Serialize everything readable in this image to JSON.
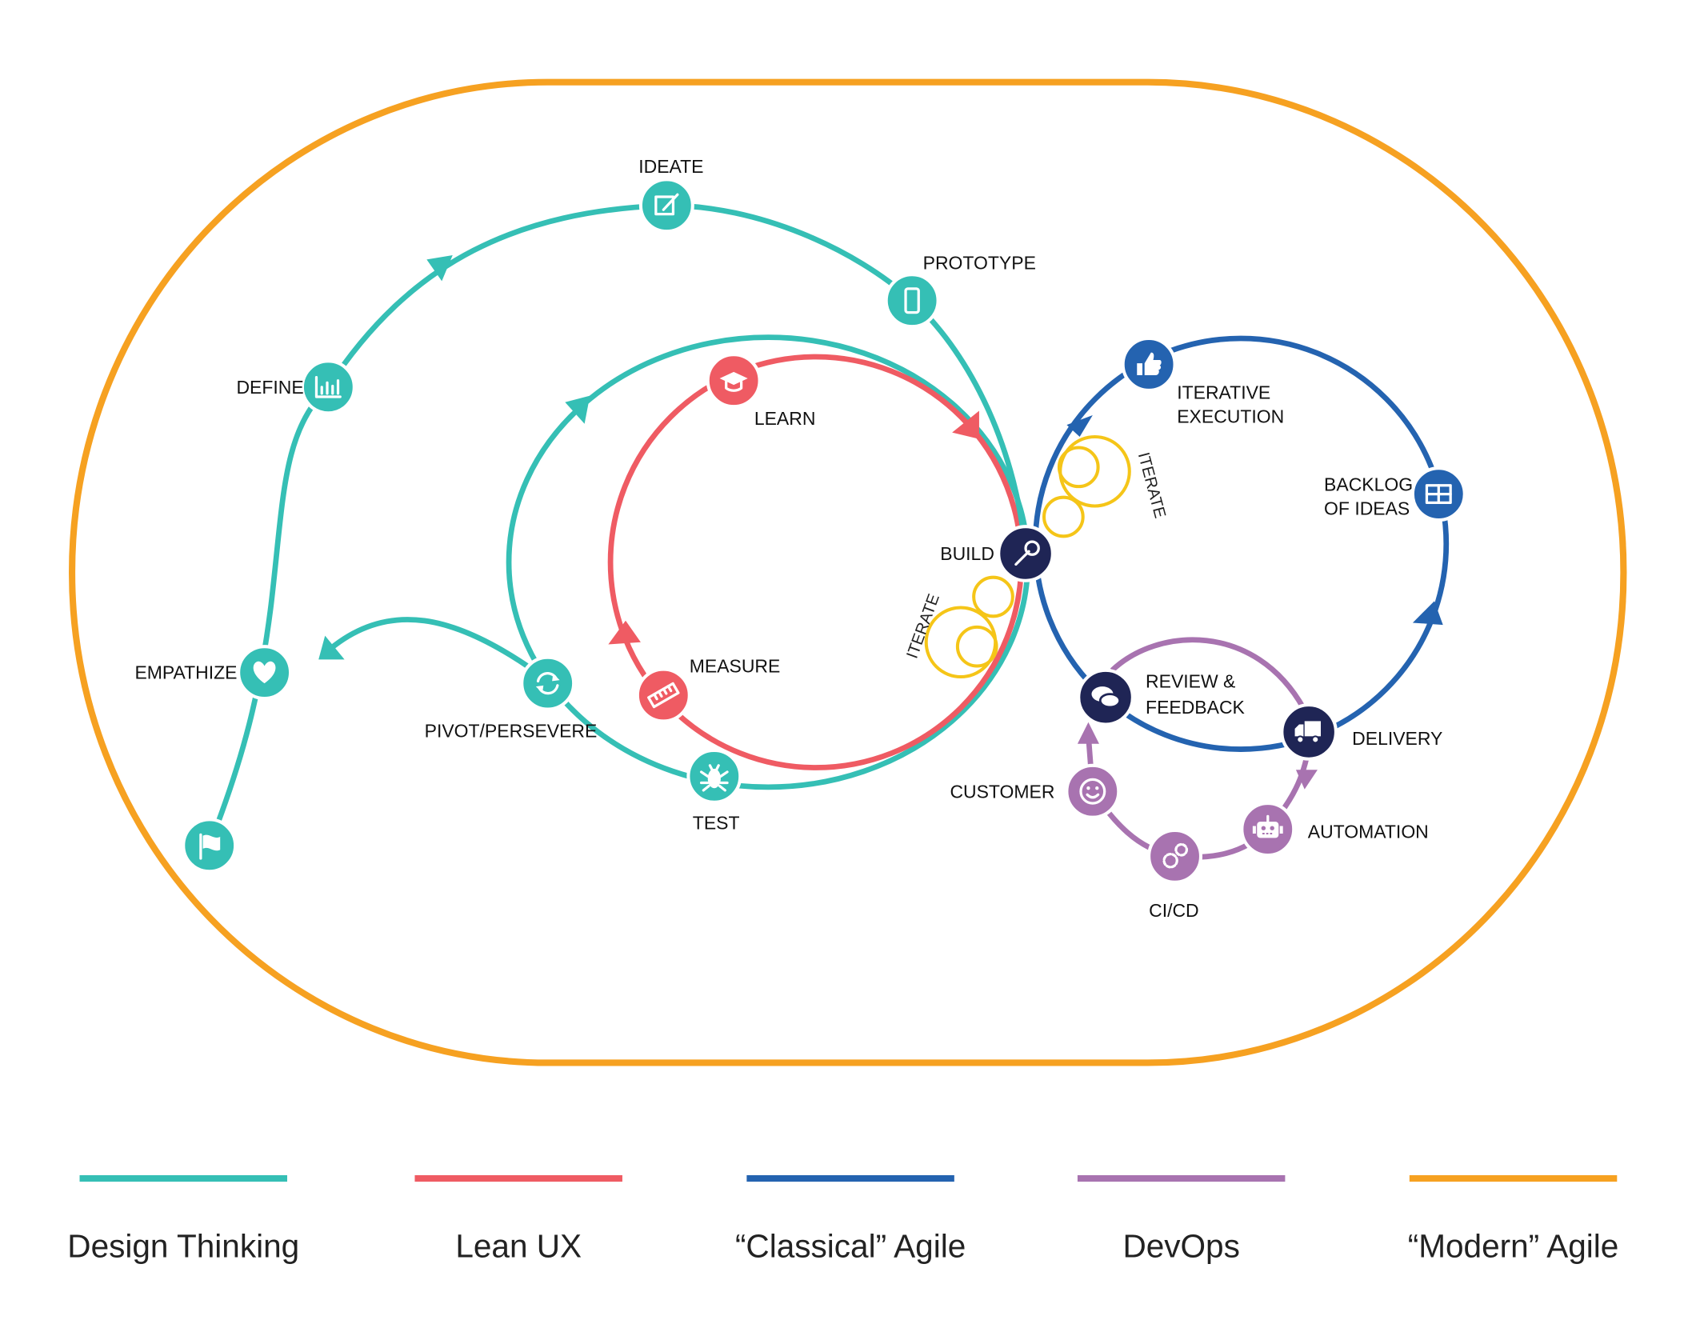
{
  "colors": {
    "design_thinking": "#35bfb5",
    "lean_ux": "#ef5b63",
    "classical_agile": "#2463b0",
    "devops": "#a873b0",
    "modern_agile": "#f6a121",
    "build_node": "#1f2555",
    "iterate_loops": "#f5c518"
  },
  "design_thinking": {
    "nodes": [
      {
        "label": "IDEATE",
        "icon": "pencil-square-icon"
      },
      {
        "label": "PROTOTYPE",
        "icon": "mobile-phone-icon"
      },
      {
        "label": "DEFINE",
        "icon": "bar-chart-icon"
      },
      {
        "label": "EMPATHIZE",
        "icon": "heart-icon"
      },
      {
        "label": "",
        "icon": "flag-icon"
      }
    ]
  },
  "lean_ux": {
    "nodes": [
      {
        "label": "LEARN",
        "icon": "graduation-cap-icon"
      },
      {
        "label": "MEASURE",
        "icon": "ruler-icon"
      },
      {
        "label": "TEST",
        "icon": "bug-icon"
      },
      {
        "label": "PIVOT/PERSEVERE",
        "icon": "refresh-icon"
      }
    ]
  },
  "shared": {
    "build": {
      "label": "BUILD",
      "icon": "wrench-icon"
    },
    "iterate_left": "ITERATE",
    "iterate_right": "ITERATE"
  },
  "agile": {
    "nodes": [
      {
        "label_lines": [
          "ITERATIVE",
          "EXECUTION"
        ],
        "icon": "thumbs-up-icon"
      },
      {
        "label_lines": [
          "BACKLOG",
          "OF IDEAS"
        ],
        "icon": "table-icon"
      },
      {
        "label_lines": [
          "REVIEW &",
          "FEEDBACK"
        ],
        "icon": "chat-bubbles-icon"
      },
      {
        "label": "DELIVERY",
        "icon": "truck-icon"
      }
    ]
  },
  "devops": {
    "nodes": [
      {
        "label": "CUSTOMER",
        "icon": "smiley-icon"
      },
      {
        "label": "CI/CD",
        "icon": "gears-icon"
      },
      {
        "label": "AUTOMATION",
        "icon": "robot-icon"
      }
    ]
  },
  "legend": [
    {
      "label": "Design Thinking",
      "color": "#35bfb5"
    },
    {
      "label": "Lean UX",
      "color": "#ef5b63"
    },
    {
      "label": "“Classical” Agile",
      "color": "#2463b0"
    },
    {
      "label": "DevOps",
      "color": "#a873b0"
    },
    {
      "label": "“Modern” Agile",
      "color": "#f6a121"
    }
  ]
}
